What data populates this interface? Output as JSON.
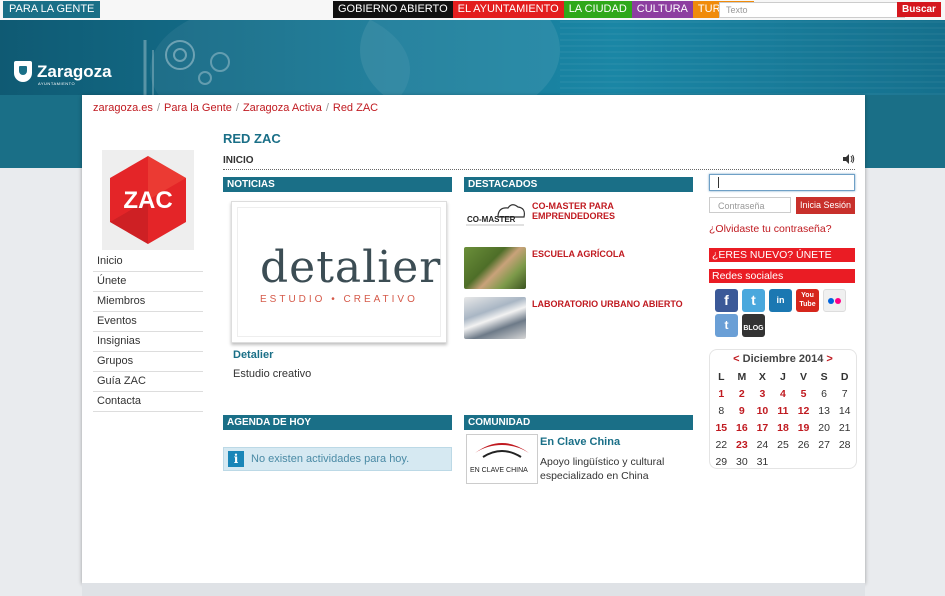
{
  "topbar": {
    "para_la_gente": "PARA LA GENTE",
    "nav": [
      {
        "label": "GOBIERNO ABIERTO",
        "color": "#111111"
      },
      {
        "label": "EL AYUNTAMIENTO",
        "color": "#e31d1d"
      },
      {
        "label": "LA CIUDAD",
        "color": "#2fa81a"
      },
      {
        "label": "CULTURA",
        "color": "#8d3ea0"
      },
      {
        "label": "TURISMO",
        "color": "#f08b0a"
      }
    ],
    "search_placeholder": "Texto",
    "search_button": "Buscar"
  },
  "header": {
    "logo_name": "Zaragoza",
    "logo_sub": "AYUNTAMIENTO"
  },
  "breadcrumb": [
    "zaragoza.es",
    "Para la Gente",
    "Zaragoza Activa",
    "Red ZAC"
  ],
  "page_title": "RED ZAC",
  "section_title": "INICIO",
  "zac_logo_text": "ZAC",
  "side_menu": [
    "Inicio",
    "Únete",
    "Miembros",
    "Eventos",
    "Insignias",
    "Grupos",
    "Guía ZAC",
    "Contacta"
  ],
  "noticias": {
    "heading": "NOTICIAS",
    "image_word": "detalier",
    "image_sub": "ESTUDIO • CREATIVO",
    "title": "Detalier",
    "description": "Estudio creativo"
  },
  "destacados": {
    "heading": "DESTACADOS",
    "items": [
      {
        "label": "CO-MASTER PARA EMPRENDEDORES",
        "thumb_text": "CO-MASTER"
      },
      {
        "label": "ESCUELA AGRÍCOLA"
      },
      {
        "label": "LABORATORIO URBANO ABIERTO"
      }
    ]
  },
  "agenda": {
    "heading": "AGENDA DE HOY",
    "message": "No existen actividades para hoy."
  },
  "comunidad": {
    "heading": "COMUNIDAD",
    "title": "En Clave China",
    "description": "Apoyo lingüístico y cultural especializado en China",
    "thumb_text": "EN CLAVE CHINA"
  },
  "login": {
    "user_value": "",
    "password_placeholder": "Contraseña",
    "button": "Inicia Sesión",
    "forgot": "¿Olvidaste tu contraseña?"
  },
  "join_bar": "¿ERES NUEVO? ÚNETE",
  "social_bar": "Redes sociales",
  "social_icons": [
    {
      "name": "facebook-icon",
      "text": "f",
      "color": "#3b5998"
    },
    {
      "name": "twitter-icon",
      "text": "t",
      "color": "#4aa8dd"
    },
    {
      "name": "linkedin-icon",
      "text": "in",
      "color": "#1b78b2"
    },
    {
      "name": "youtube-icon",
      "text": "You Tube",
      "color": "#d6261c"
    },
    {
      "name": "flickr-icon",
      "text": "••",
      "color": "#f0f0f0"
    },
    {
      "name": "tuenti-icon",
      "text": "t",
      "color": "#6a9fd6"
    },
    {
      "name": "blog-icon",
      "text": "BLOG",
      "color": "#333333"
    }
  ],
  "calendar": {
    "prev": "<",
    "next": ">",
    "month": "Diciembre 2014",
    "weekdays": [
      "L",
      "M",
      "X",
      "J",
      "V",
      "S",
      "D"
    ],
    "days": [
      {
        "d": "1",
        "ev": true
      },
      {
        "d": "2",
        "ev": true
      },
      {
        "d": "3",
        "ev": true
      },
      {
        "d": "4",
        "ev": true
      },
      {
        "d": "5",
        "ev": true
      },
      {
        "d": "6",
        "ev": false
      },
      {
        "d": "7",
        "ev": false
      },
      {
        "d": "8",
        "ev": false
      },
      {
        "d": "9",
        "ev": true
      },
      {
        "d": "10",
        "ev": true
      },
      {
        "d": "11",
        "ev": true
      },
      {
        "d": "12",
        "ev": true
      },
      {
        "d": "13",
        "ev": false
      },
      {
        "d": "14",
        "ev": false
      },
      {
        "d": "15",
        "ev": true
      },
      {
        "d": "16",
        "ev": true
      },
      {
        "d": "17",
        "ev": true
      },
      {
        "d": "18",
        "ev": true
      },
      {
        "d": "19",
        "ev": true
      },
      {
        "d": "20",
        "ev": false
      },
      {
        "d": "21",
        "ev": false
      },
      {
        "d": "22",
        "ev": false
      },
      {
        "d": "23",
        "ev": true
      },
      {
        "d": "24",
        "ev": false
      },
      {
        "d": "25",
        "ev": false
      },
      {
        "d": "26",
        "ev": false
      },
      {
        "d": "27",
        "ev": false
      },
      {
        "d": "28",
        "ev": false
      },
      {
        "d": "29",
        "ev": false
      },
      {
        "d": "30",
        "ev": false
      },
      {
        "d": "31",
        "ev": false
      }
    ]
  },
  "colors": {
    "brand_teal": "#1a6f87",
    "accent_red": "#c01a20",
    "zac_red": "#e42528"
  }
}
